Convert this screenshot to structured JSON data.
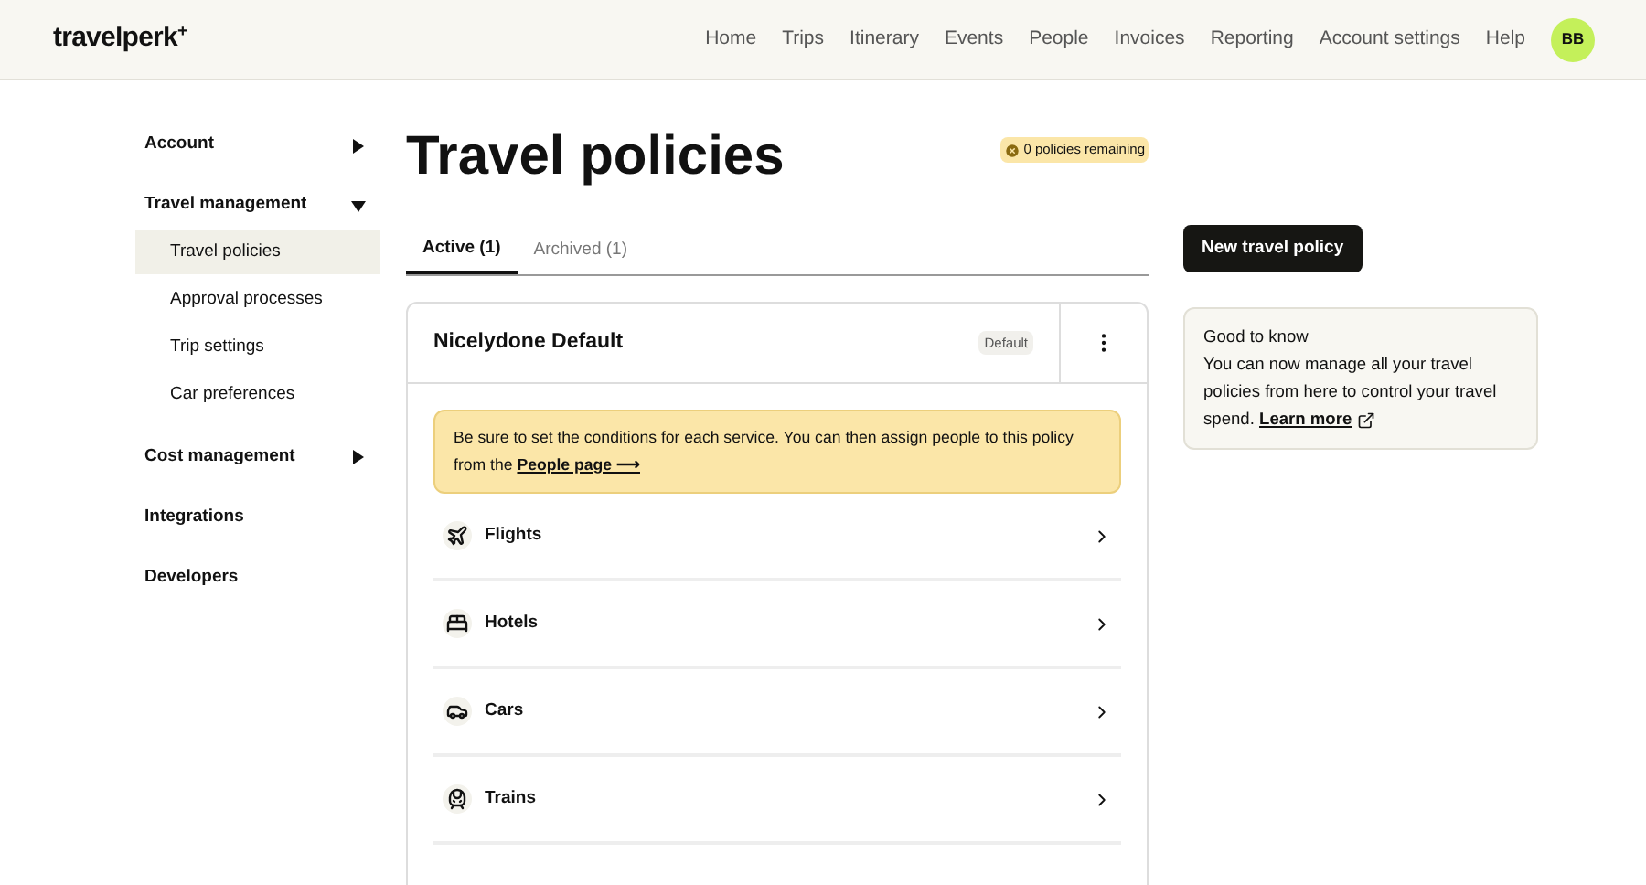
{
  "header": {
    "logo": "travelperk",
    "logo_mark": "+",
    "nav": [
      {
        "label": "Home"
      },
      {
        "label": "Trips"
      },
      {
        "label": "Itinerary"
      },
      {
        "label": "Events"
      },
      {
        "label": "People"
      },
      {
        "label": "Invoices"
      },
      {
        "label": "Reporting"
      },
      {
        "label": "Account settings"
      },
      {
        "label": "Help"
      }
    ],
    "avatar": "BB"
  },
  "sidebar": {
    "items": [
      {
        "label": "Account",
        "expanded": false
      },
      {
        "label": "Travel management",
        "expanded": true,
        "children": [
          {
            "label": "Travel policies",
            "selected": true
          },
          {
            "label": "Approval processes",
            "selected": false
          },
          {
            "label": "Trip settings",
            "selected": false
          },
          {
            "label": "Car preferences",
            "selected": false
          }
        ]
      },
      {
        "label": "Cost management",
        "expanded": false
      },
      {
        "label": "Integrations"
      },
      {
        "label": "Developers"
      }
    ]
  },
  "page": {
    "title": "Travel policies",
    "remaining_badge": "0 policies remaining",
    "tabs": [
      {
        "label": "Active (1)",
        "selected": true
      },
      {
        "label": "Archived (1)",
        "selected": false
      }
    ],
    "policy": {
      "name": "Nicelydone Default",
      "badge": "Default",
      "notice": "Be sure to set the conditions for each service. You can then assign people to this policy from the",
      "notice_link": "People page ⟶",
      "services": [
        {
          "kind": "flights",
          "label": "Flights"
        },
        {
          "kind": "hotels",
          "label": "Hotels"
        },
        {
          "kind": "cars",
          "label": "Cars"
        },
        {
          "kind": "trains",
          "label": "Trains"
        }
      ]
    }
  },
  "aside": {
    "button": "New travel policy",
    "info_title": "Good to know",
    "info_text": "You can now manage all your travel policies from here to control your travel spend.",
    "info_link": "Learn more"
  }
}
